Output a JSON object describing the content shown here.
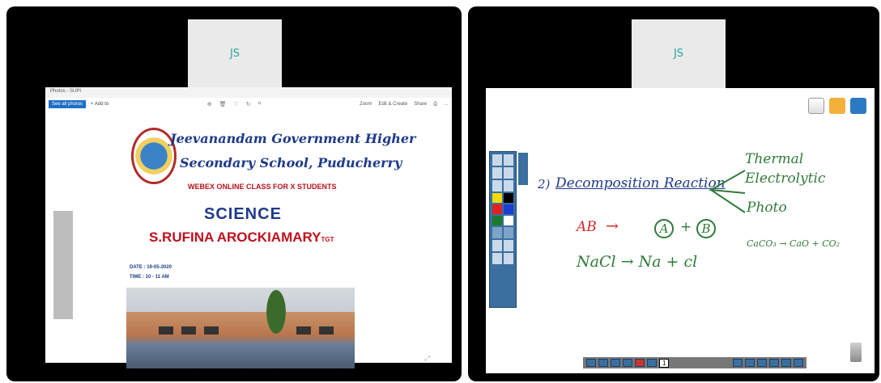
{
  "left_panel": {
    "participant_initials": "JS",
    "photos_window": {
      "title": "Photos - SUPI",
      "toolbar": {
        "see_all_label": "See all photos",
        "add_label": "+ Add to",
        "zoom_label": "Zoom",
        "edit_label": "Edit & Create",
        "share_label": "Share"
      }
    },
    "slide": {
      "school_line1": "Jeevanandam Government Higher",
      "school_line2": "Secondary School, Puducherry",
      "webex_line": "WEBEX ONLINE CLASS FOR X STUDENTS",
      "subject": "SCIENCE",
      "teacher": "S.RUFINA AROCKIAMARY",
      "teacher_suffix": "TGT",
      "date_line": "DATE : 19-05-2020",
      "time_line": "TIME : 10 - 11 AM"
    }
  },
  "right_panel": {
    "participant_initials": "JS",
    "whiteboard": {
      "heading_number": "2)",
      "heading": "Decomposition Reaction",
      "types": [
        "Thermal",
        "Electrolytic",
        "Photo"
      ],
      "eq1_left": "AB",
      "eq1_arrow": "→",
      "eq1_a": "A",
      "eq1_plus": "+",
      "eq1_b": "B",
      "eq2": "NaCl → Na + cl",
      "eq3": "CaCO₃ → CaO + CO₂",
      "page_number": "1"
    }
  },
  "colors": {
    "panel_bg": "#000000",
    "accent_blue": "#1e3a8a",
    "accent_red": "#c0111d",
    "ink_green": "#2f7a38"
  }
}
